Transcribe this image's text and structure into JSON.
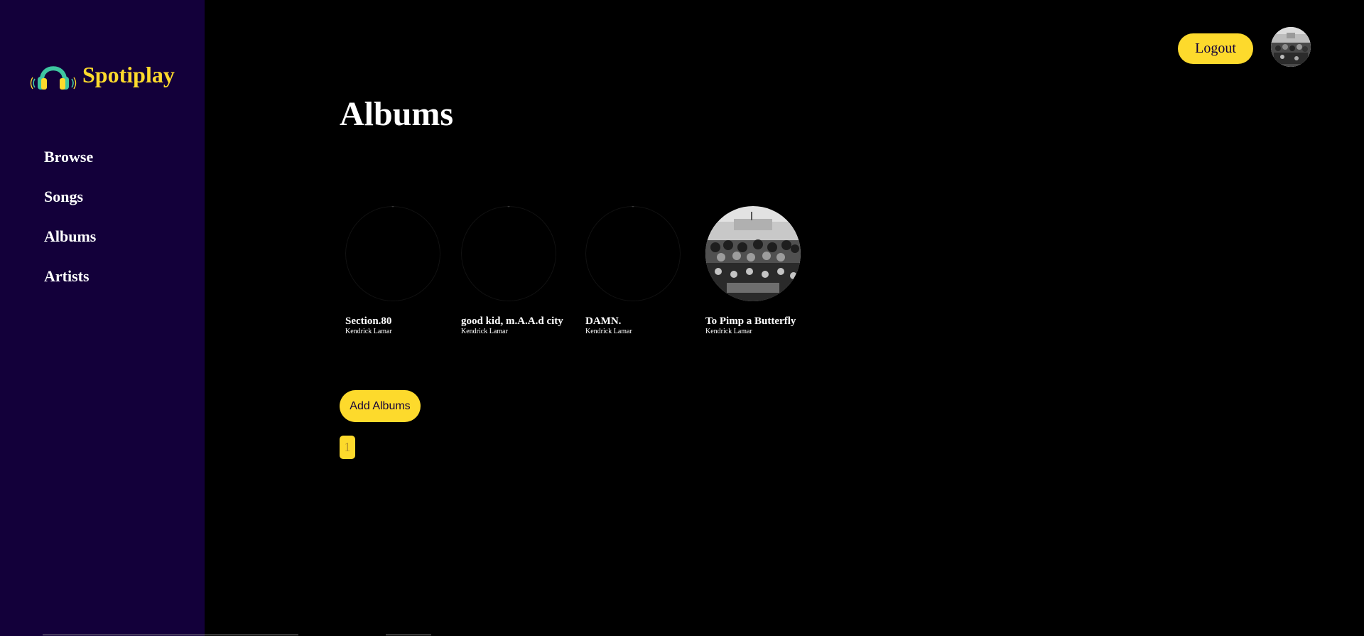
{
  "brand": {
    "name": "Spotiplay",
    "icon": "headphones-icon"
  },
  "nav": {
    "items": [
      {
        "label": "Browse"
      },
      {
        "label": "Songs"
      },
      {
        "label": "Albums"
      },
      {
        "label": "Artists"
      }
    ]
  },
  "header": {
    "logout_label": "Logout",
    "avatar_icon": "user-avatar"
  },
  "main": {
    "title": "Albums",
    "albums": [
      {
        "title": "Section.80",
        "artist": "Kendrick Lamar",
        "cover_loaded": false
      },
      {
        "title": "good kid, m.A.A.d city",
        "artist": "Kendrick Lamar",
        "cover_loaded": false
      },
      {
        "title": "DAMN.",
        "artist": "Kendrick Lamar",
        "cover_loaded": false
      },
      {
        "title": "To Pimp a Butterfly",
        "artist": "Kendrick Lamar",
        "cover_loaded": true
      }
    ],
    "add_label": "Add Albums",
    "pagination": {
      "current_page": "1"
    }
  },
  "colors": {
    "sidebar_bg": "#13003a",
    "background": "#000000",
    "accent": "#fdda2c",
    "headphones_green": "#3ec6a0",
    "text": "#ffffff"
  }
}
